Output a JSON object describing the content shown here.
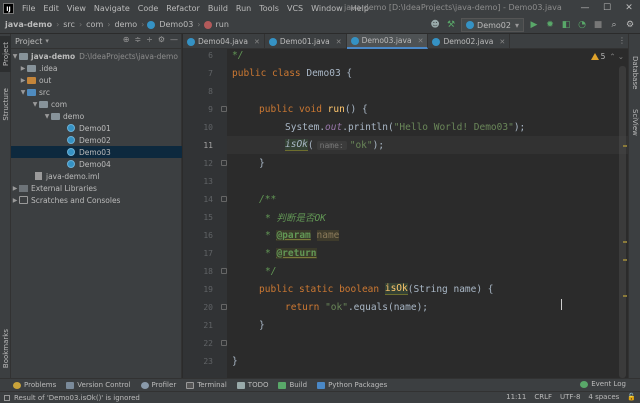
{
  "menubar": {
    "logo": "IJ",
    "items": [
      "File",
      "Edit",
      "View",
      "Navigate",
      "Code",
      "Refactor",
      "Build",
      "Run",
      "Tools",
      "VCS",
      "Window",
      "Help"
    ],
    "title": "java-demo [D:\\IdeaProjects\\java-demo] - Demo03.java",
    "controls": [
      "—",
      "☐",
      "✕"
    ]
  },
  "navbar": {
    "crumbs": [
      "java-demo",
      "src",
      "com",
      "demo",
      "Demo03",
      "run"
    ],
    "run_config": "Demo02"
  },
  "left_strip": {
    "tabs": [
      "Project",
      "Structure",
      "Bookmarks"
    ]
  },
  "right_strip": {
    "tabs": [
      "Database",
      "SciView"
    ]
  },
  "project_panel": {
    "title": "Project",
    "root": {
      "name": "java-demo",
      "path": "D:\\IdeaProjects\\java-demo"
    },
    "tree": [
      {
        "label": ".idea"
      },
      {
        "label": "out"
      },
      {
        "label": "src"
      },
      {
        "label": "com"
      },
      {
        "label": "demo"
      },
      {
        "label": "Demo01"
      },
      {
        "label": "Demo02"
      },
      {
        "label": "Demo03"
      },
      {
        "label": "Demo04"
      },
      {
        "label": "java-demo.iml"
      },
      {
        "label": "External Libraries"
      },
      {
        "label": "Scratches and Consoles"
      }
    ]
  },
  "editor_tabs": [
    {
      "label": "Demo04.java"
    },
    {
      "label": "Demo01.java"
    },
    {
      "label": "Demo03.java",
      "active": true
    },
    {
      "label": "Demo02.java"
    }
  ],
  "editor": {
    "line_numbers": [
      "6",
      "7",
      "8",
      "9",
      "10",
      "11",
      "12",
      "13",
      "14",
      "15",
      "16",
      "17",
      "18",
      "19",
      "20",
      "21",
      "22",
      "23"
    ],
    "current_line": "11",
    "warnings_count": "5",
    "code": {
      "l6": "*/",
      "l7_kw": "public class",
      "l7_name": " Demo03 {",
      "l9_kw": "public void",
      "l9_fn": "run",
      "l9_rest": "() {",
      "l10_a": "System.",
      "l10_out": "out",
      "l10_b": ".println(",
      "l10_str": "\"Hello World! Demo03\"",
      "l10_c": ");",
      "l11_call": "isOk",
      "l11_open": "(",
      "l11_hint": "name:",
      "l11_str": "\"ok\"",
      "l11_close": ");",
      "l12": "}",
      "l14": "/**",
      "l15": "* 判断是否OK",
      "l16_star": "* ",
      "l16_tag": "@param",
      "l16_name": "name",
      "l17_star": "* ",
      "l17_tag": "@return",
      "l18": "*/",
      "l19_kw": "public static boolean",
      "l19_fn": "isOk",
      "l19_rest": "(String name) {",
      "l20_kw": "return",
      "l20_str": "\"ok\"",
      "l20_rest": ".equals(name);",
      "l21": "}",
      "l23": "}"
    }
  },
  "bottom_tools": [
    "Problems",
    "Version Control",
    "Profiler",
    "Terminal",
    "TODO",
    "Build",
    "Python Packages"
  ],
  "event_log": "Event Log",
  "status": {
    "message": "Result of 'Demo03.isOk()' is ignored",
    "position": "11:11",
    "line_sep": "CRLF",
    "encoding": "UTF-8",
    "indent": "4 spaces"
  }
}
